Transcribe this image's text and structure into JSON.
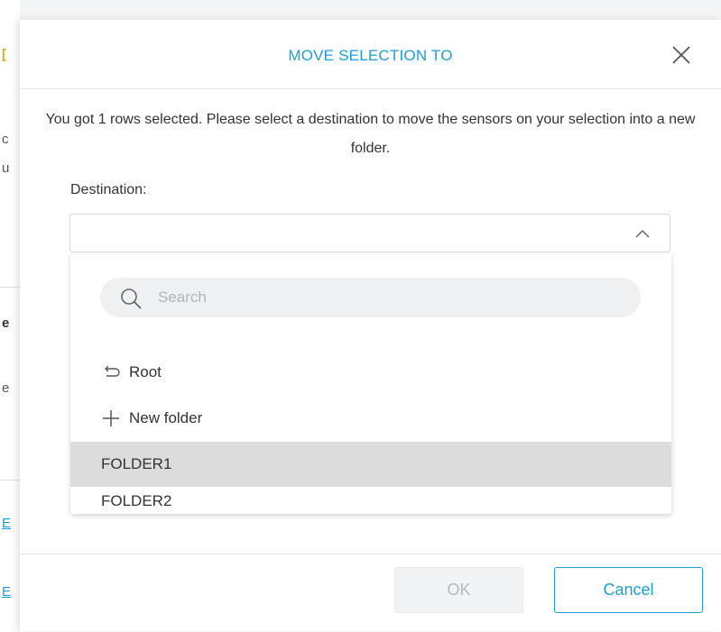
{
  "background": {
    "fragments": [
      "[",
      "c",
      "u",
      "e",
      "e",
      "E",
      "E"
    ]
  },
  "modal": {
    "title": "MOVE SELECTION TO",
    "close_icon": "close-icon",
    "intro_text": "You got 1 rows selected. Please select a destination to move the sensors on your selection into a new folder.",
    "destination_label": "Destination:",
    "destination_value": "",
    "search_placeholder": "Search",
    "items": [
      {
        "label": "Root",
        "icon": "undo-arrow-icon"
      },
      {
        "label": "New folder",
        "icon": "plus-icon"
      },
      {
        "label": "FOLDER1",
        "selected": true
      },
      {
        "label": "FOLDER2"
      }
    ],
    "ok_label": "OK",
    "cancel_label": "Cancel"
  },
  "colors": {
    "accent": "#1a9fd8",
    "selected_row": "#dcdcdc"
  }
}
